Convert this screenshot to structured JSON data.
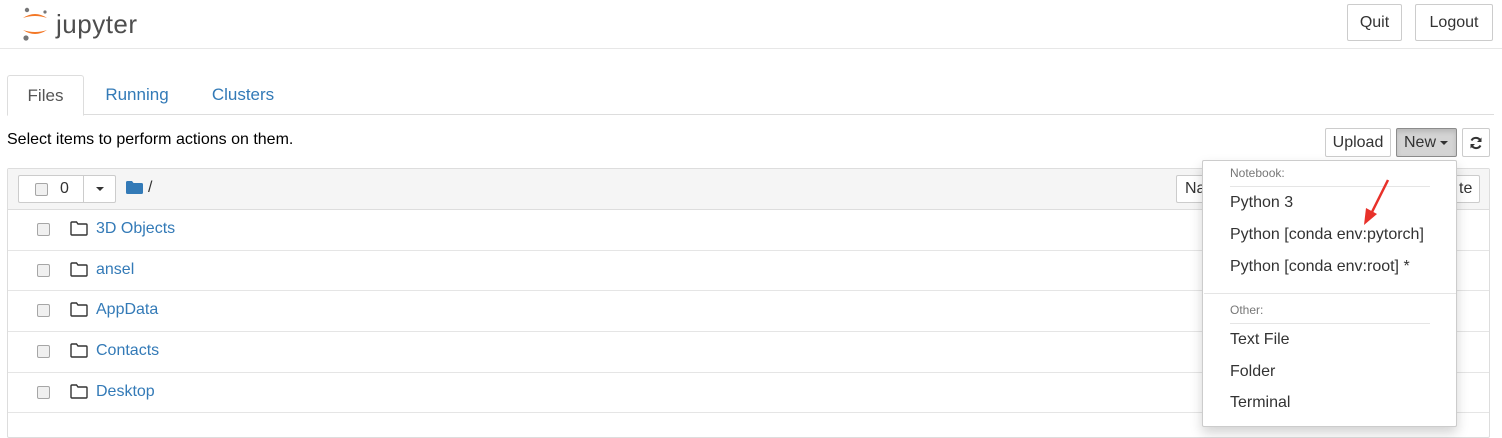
{
  "header": {
    "logo_text": "jupyter",
    "quit_label": "Quit",
    "logout_label": "Logout"
  },
  "tabs": [
    {
      "label": "Files",
      "active": true
    },
    {
      "label": "Running",
      "active": false
    },
    {
      "label": "Clusters",
      "active": false
    }
  ],
  "toolbar": {
    "instructions": "Select items to perform actions on them.",
    "upload_label": "Upload",
    "new_label": "New",
    "refresh_icon": "refresh-icon"
  },
  "list": {
    "selected_count": "0",
    "breadcrumb": "/",
    "sort_partial": "Na",
    "right_partial": "te",
    "items": [
      {
        "name": "3D Objects",
        "type": "folder"
      },
      {
        "name": "ansel",
        "type": "folder"
      },
      {
        "name": "AppData",
        "type": "folder"
      },
      {
        "name": "Contacts",
        "type": "folder"
      },
      {
        "name": "Desktop",
        "type": "folder"
      }
    ]
  },
  "new_menu": {
    "notebook_header": "Notebook:",
    "notebook_items": [
      "Python 3",
      "Python [conda env:pytorch]",
      "Python [conda env:root] *"
    ],
    "other_header": "Other:",
    "other_items": [
      "Text File",
      "Folder",
      "Terminal"
    ]
  },
  "colors": {
    "link": "#337ab7",
    "logo_orange": "#f37726",
    "annotation_arrow": "#e8312a"
  }
}
